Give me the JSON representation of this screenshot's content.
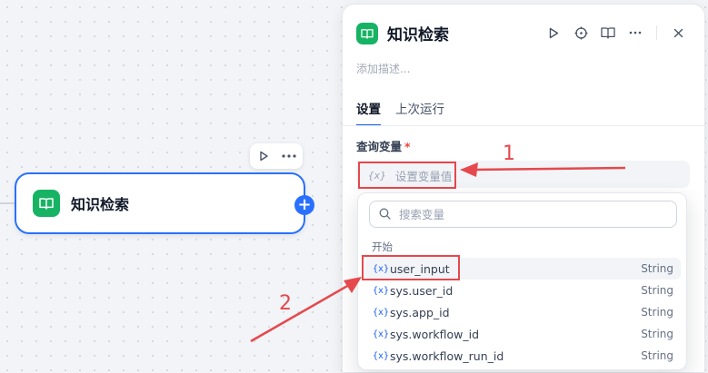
{
  "canvas": {
    "node": {
      "title": "知识检索"
    }
  },
  "panel": {
    "title": "知识检索",
    "description_placeholder": "添加描述...",
    "tabs": [
      {
        "label": "设置"
      },
      {
        "label": "上次运行"
      }
    ],
    "query_variable": {
      "label": "查询变量",
      "required_mark": "*",
      "icon_glyph": "{x}",
      "placeholder": "设置变量值"
    }
  },
  "dropdown": {
    "search_placeholder": "搜索变量",
    "group_label": "开始",
    "items": [
      {
        "name": "user_input",
        "type": "String"
      },
      {
        "name": "sys.user_id",
        "type": "String"
      },
      {
        "name": "sys.app_id",
        "type": "String"
      },
      {
        "name": "sys.workflow_id",
        "type": "String"
      },
      {
        "name": "sys.workflow_run_id",
        "type": "String"
      }
    ],
    "item_icon": "{x}"
  },
  "annotations": {
    "label_1": "1",
    "label_2": "2"
  },
  "colors": {
    "accent": "#2970ff",
    "app_icon": "#16b364",
    "annotation": "#e5484d"
  }
}
